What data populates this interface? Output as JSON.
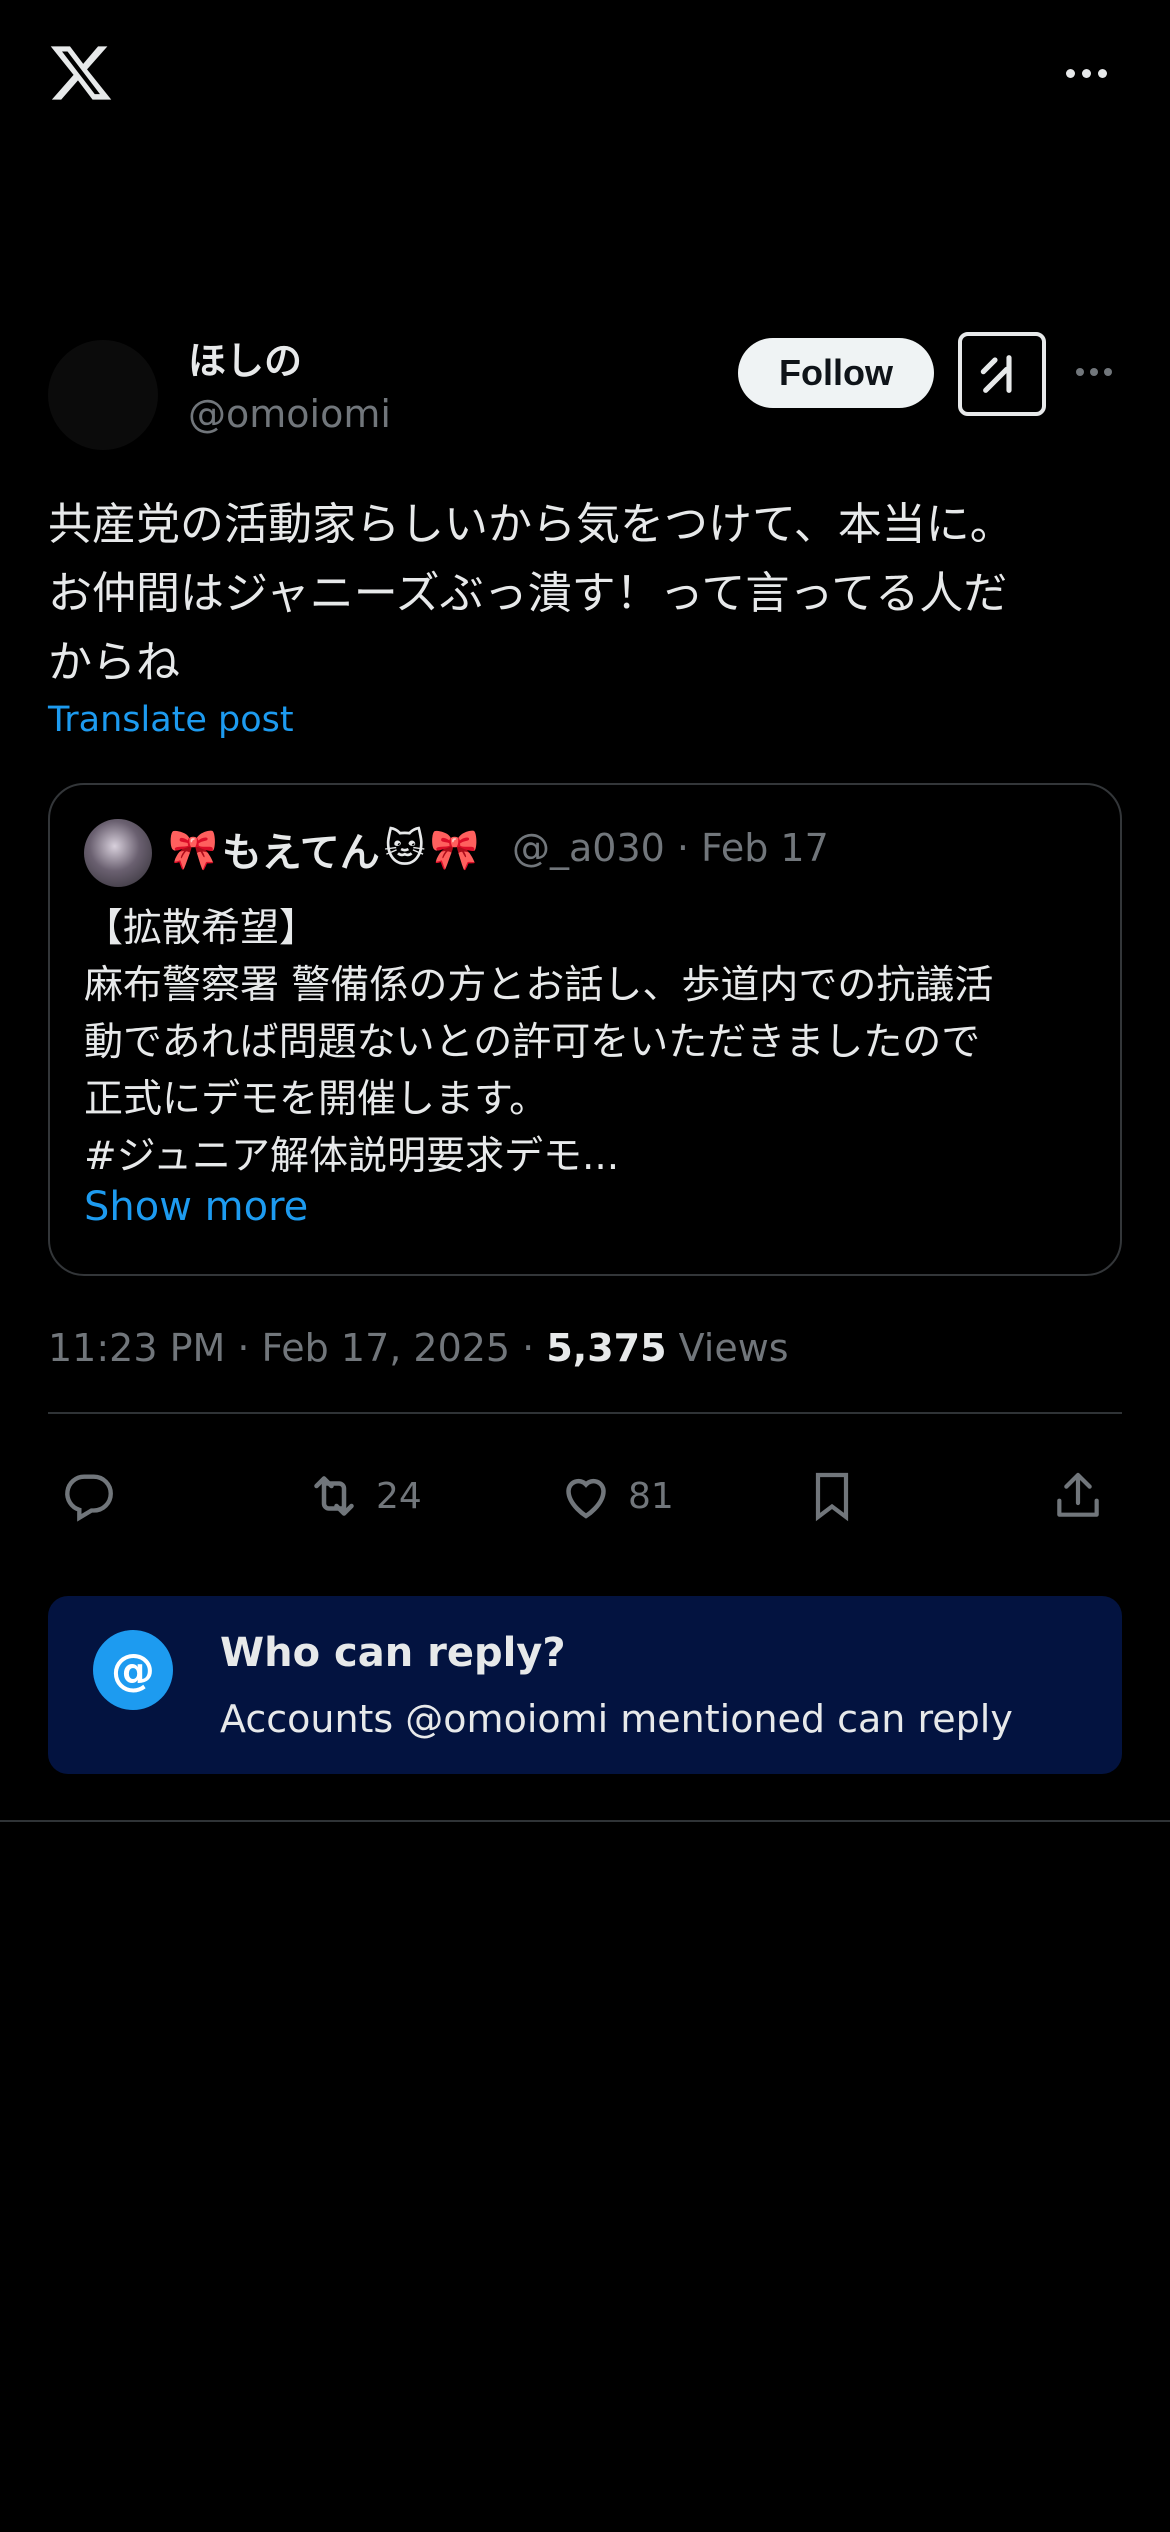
{
  "topbar": {
    "logo_icon": "x-logo-icon",
    "more_icon": "more-horizontal-icon"
  },
  "post": {
    "author_name": "ほしの",
    "author_handle": "@omoiomi",
    "follow_label": "Follow",
    "text": "共産党の活動家らしいから気をつけて、本当に。\nお仲間はジャニーズぶっ潰す！って言ってる人だ\nからね",
    "translate_label": "Translate post",
    "time": "11:23 PM · Feb 17, 2025 · ",
    "views_count": "5,375",
    "views_label": " Views"
  },
  "quote": {
    "name": "もえてん",
    "emoji_left": "🎀",
    "emoji_cat": "🐱",
    "emoji_right": "🎀",
    "meta": "@_a030 · Feb 17",
    "text": "【拡散希望】\n麻布警察署 警備係の方とお話し、歩道内での抗議活\n動であれば問題ないとの許可をいただきましたので\n正式にデモを開催します。\n#ジュニア解体説明要求デモ...",
    "show_more": "Show more"
  },
  "actions": {
    "reply_count": "",
    "repost_count": "24",
    "like_count": "81"
  },
  "reply_banner": {
    "icon_text": "@",
    "title": "Who can reply?",
    "subtitle": "Accounts @omoiomi mentioned can reply"
  },
  "colors": {
    "accent": "#1d9bf0",
    "banner_bg": "#031340",
    "muted": "#71767b"
  }
}
